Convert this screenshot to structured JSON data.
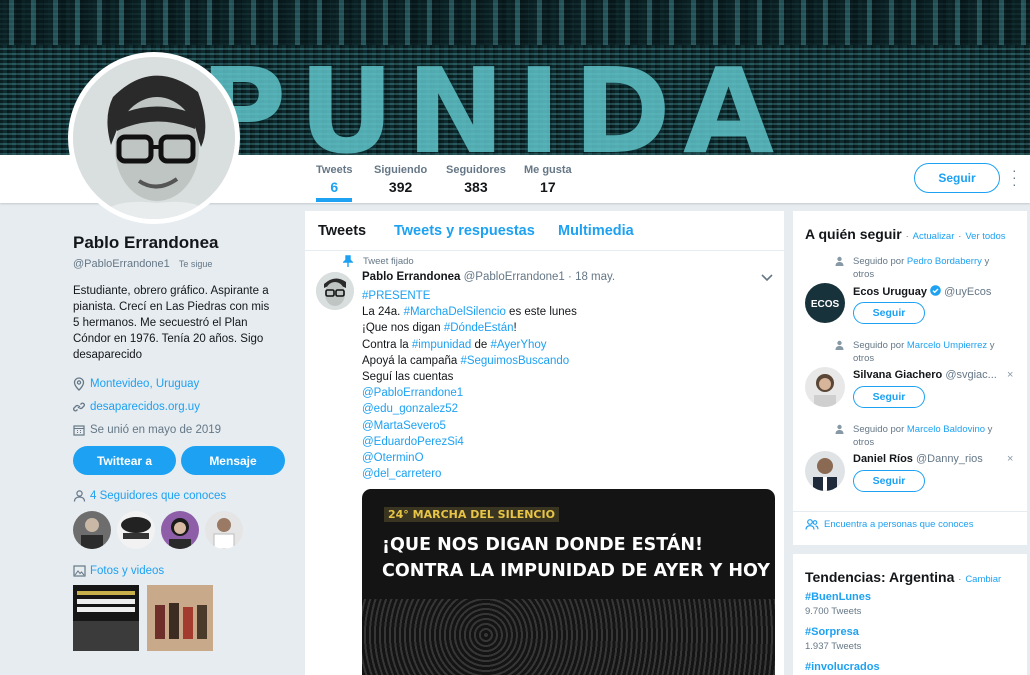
{
  "banner": {
    "text": "PUNIDA"
  },
  "stats": [
    {
      "label": "Tweets",
      "value": "6"
    },
    {
      "label": "Siguiendo",
      "value": "392"
    },
    {
      "label": "Seguidores",
      "value": "383"
    },
    {
      "label": "Me gusta",
      "value": "17"
    }
  ],
  "nav": {
    "follow_label": "Seguir",
    "more_icon": "more-vertical-icon"
  },
  "profile": {
    "name": "Pablo Errandonea",
    "handle": "@PabloErrandone1",
    "follows_you": "Te sigue",
    "bio": "Estudiante, obrero gráfico. Aspirante a pianista. Crecí en Las Piedras con mis 5 hermanos. Me secuestró el Plan Cóndor en 1976. Tenía 20 años. Sigo desaparecido",
    "location": "Montevideo, Uruguay",
    "website": "desaparecidos.org.uy",
    "joined": "Se unió en mayo de 2019",
    "tweet_to_label": "Twittear a",
    "message_label": "Mensaje",
    "known_followers": "4 Seguidores que conoces",
    "photos_label": "Fotos y videos"
  },
  "timeline": {
    "tabs": [
      "Tweets",
      "Tweets y respuestas",
      "Multimedia"
    ],
    "pinned_label": "Tweet fijado",
    "tweet": {
      "name": "Pablo Errandonea",
      "handle": "@PabloErrandone1",
      "sep": "·",
      "date": "18 may.",
      "line1_tag": "#PRESENTE",
      "line2_pre": "La 24a. ",
      "line2_tag": "#MarchaDelSilencio",
      "line2_post": " es este lunes",
      "line3_pre": "¡Que nos digan ",
      "line3_tag": "#DóndeEstán",
      "line3_post": "!",
      "line4_pre": "Contra la ",
      "line4_tag1": "#impunidad",
      "line4_mid": " de ",
      "line4_tag2": "#AyerYhoy",
      "line5_pre": "Apoyá la campaña ",
      "line5_tag": "#SeguimosBuscando",
      "line6": "Seguí las cuentas",
      "mentions": [
        "@PabloErrandone1",
        "@edu_gonzalez52",
        "@MartaSevero5",
        "@EduardoPerezSi4",
        "@OterminO",
        "@del_carretero"
      ],
      "media": {
        "kicker": "24° MARCHA DEL SILENCIO",
        "line1": "¡QUE NOS DIGAN DONDE ESTÁN!",
        "line2": "CONTRA LA IMPUNIDAD DE AYER Y HOY"
      }
    }
  },
  "who_to_follow": {
    "title": "A quién seguir",
    "sep": "·",
    "refresh": "Actualizar",
    "view_all": "Ver todos",
    "items": [
      {
        "ctx_prefix": "Seguido por ",
        "ctx_name": "Pedro Bordaberry",
        "ctx_suffix": " y otros",
        "name": "Ecos Uruguay",
        "handle": "@uyEcos",
        "verified": true,
        "button": "Seguir"
      },
      {
        "ctx_prefix": "Seguido por ",
        "ctx_name": "Marcelo Umpierrez",
        "ctx_suffix": " y otros",
        "name": "Silvana Giachero",
        "handle": "@svgiac...",
        "verified": false,
        "button": "Seguir"
      },
      {
        "ctx_prefix": "Seguido por ",
        "ctx_name": "Marcelo Baldovino",
        "ctx_suffix": " y otros",
        "name": "Daniel Ríos",
        "handle": "@Danny_rios",
        "verified": false,
        "button": "Seguir"
      }
    ],
    "find_people": "Encuentra a personas que conoces",
    "dismiss": "×"
  },
  "trends": {
    "title": "Tendencias: Argentina",
    "sep": "·",
    "change": "Cambiar",
    "items": [
      {
        "tag": "#BuenLunes",
        "count": "9.700 Tweets"
      },
      {
        "tag": "#Sorpresa",
        "count": "1.937 Tweets"
      },
      {
        "tag": "#involucrados",
        "count": ""
      }
    ]
  },
  "colors": {
    "accent": "#1da1f2",
    "background": "#e6ecf0",
    "text": "#14171a",
    "muted": "#657786",
    "banner": "#0f3135"
  }
}
